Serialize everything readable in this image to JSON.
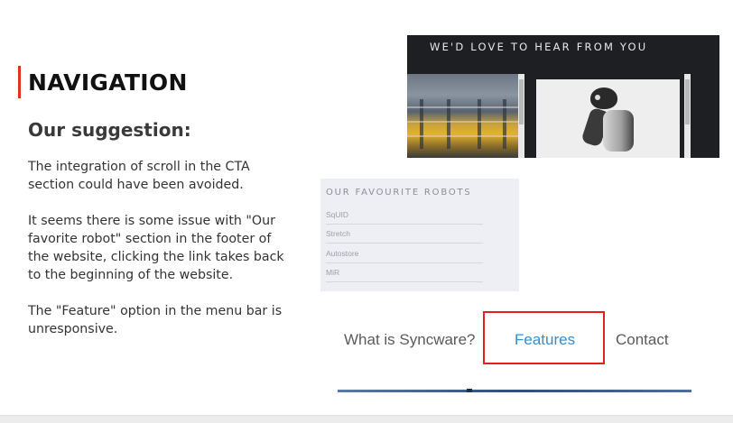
{
  "slide": {
    "heading": "NAVIGATION",
    "subheading": "Our suggestion:",
    "paragraphs": [
      "The integration of scroll in the CTA section could have been avoided.",
      "It seems there is some issue with \"Our favorite robot\" section in the footer of the website, clicking the link takes back to the beginning of the website.",
      "The \"Feature\" option in the menu bar is unresponsive."
    ]
  },
  "contact_screenshot": {
    "title": "WE'D LOVE TO HEAR FROM YOU"
  },
  "robots_screenshot": {
    "title": "OUR FAVOURITE ROBOTS",
    "items": [
      "SqUID",
      "Stretch",
      "Autostore",
      "MiR"
    ]
  },
  "menu_screenshot": {
    "items": [
      "What is Syncware?",
      "Features",
      "Contact"
    ]
  },
  "colors": {
    "accent": "#e0301e",
    "link_blue": "#2d8fd6",
    "highlight_border": "#e0201c"
  }
}
